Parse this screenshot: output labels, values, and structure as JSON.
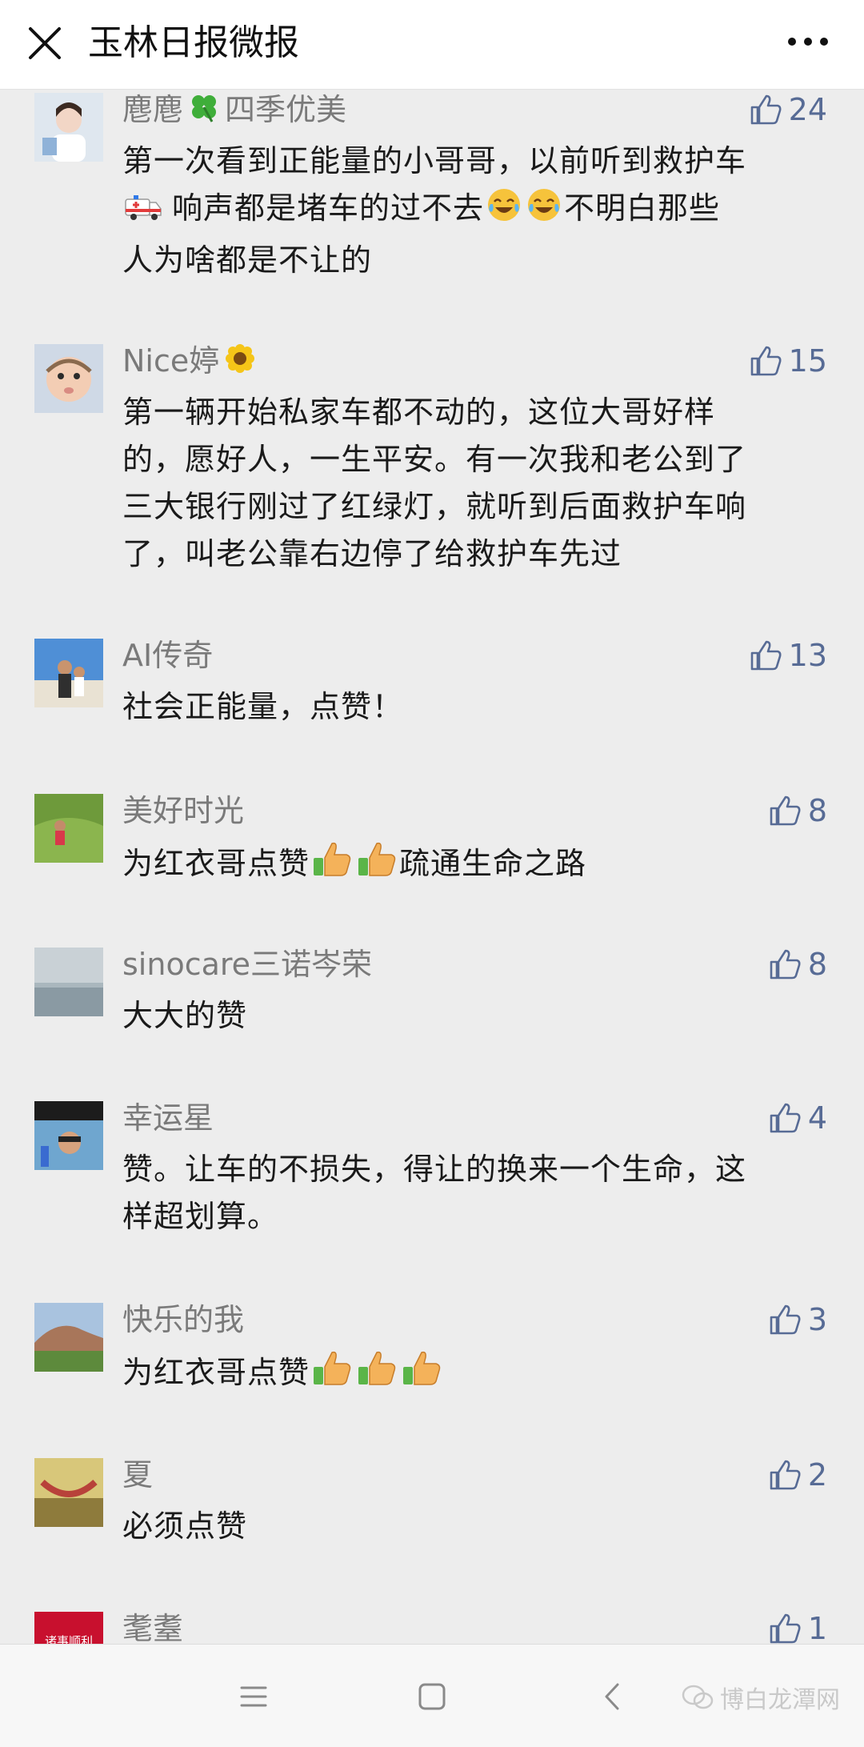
{
  "header": {
    "title": "玉林日报微报",
    "close_icon": "close-icon",
    "more_icon": "more-dots-icon"
  },
  "comments": [
    {
      "nickname": "麀麀",
      "nick_suffix": "四季优美",
      "nick_emoji": "four-leaf-clover",
      "likes": "24",
      "lines": [
        "第一次看到正能量的小哥哥，以前听到救护车",
        "响声都是堵车的过不去",
        "不明白那些",
        "人为啥都是不让的"
      ]
    },
    {
      "nickname": "Nice婷",
      "nick_emoji": "sunflower",
      "likes": "15",
      "lines": [
        "第一辆开始私家车都不动的，这位大哥好样",
        "的，愿好人，一生平安。有一次我和老公到了",
        "三大银行刚过了红绿灯，就听到后面救护车响",
        "了，叫老公靠右边停了给救护车先过"
      ]
    },
    {
      "nickname": "AI传奇",
      "likes": "13",
      "lines": [
        "社会正能量，点赞！"
      ]
    },
    {
      "nickname": "美好时光",
      "likes": "8",
      "lines": [
        "为红衣哥点赞",
        "疏通生命之路"
      ]
    },
    {
      "nickname": "sinocare三诺岑荣",
      "likes": "8",
      "lines": [
        "大大的赞"
      ]
    },
    {
      "nickname": "幸运星",
      "likes": "4",
      "lines": [
        "赞。让车的不损失，得让的换来一个生命，这",
        "样超划算。"
      ]
    },
    {
      "nickname": "快乐的我",
      "likes": "3",
      "lines": [
        "为红衣哥点赞"
      ]
    },
    {
      "nickname": "夏",
      "likes": "2",
      "lines": [
        "必须点赞"
      ]
    },
    {
      "nickname": "耄耋",
      "likes": "1",
      "avatar_text": "诸事顺利"
    }
  ],
  "navbar": {
    "menu_icon": "menu-icon",
    "home_icon": "home-square-icon",
    "back_icon": "back-chevron-icon",
    "watermark": "博白龙潭网"
  },
  "colors": {
    "like_blue": "#576b95",
    "nickname_gray": "#7a7a7a",
    "background": "#ededed"
  }
}
